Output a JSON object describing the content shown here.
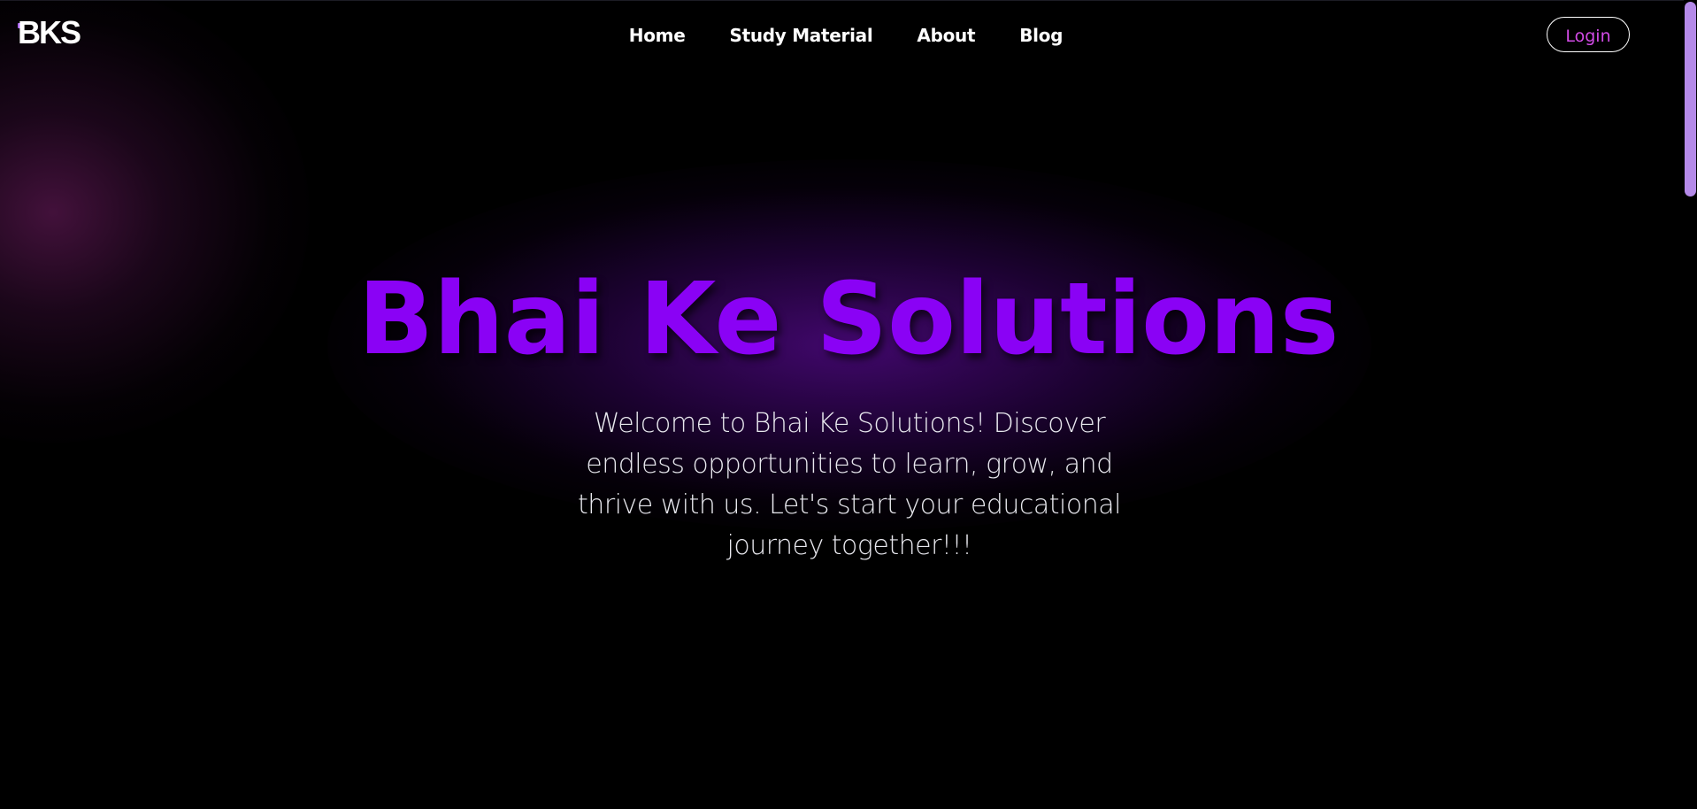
{
  "header": {
    "logo_text": "BKS",
    "nav": [
      {
        "label": "Home"
      },
      {
        "label": "Study Material"
      },
      {
        "label": "About"
      },
      {
        "label": "Blog"
      }
    ],
    "login_label": "Login"
  },
  "hero": {
    "title": "Bhai Ke Solutions",
    "subtitle": "Welcome to Bhai Ke Solutions! Discover endless opportunities to learn, grow, and thrive with us. Let's start your educational journey together!!!"
  },
  "colors": {
    "background": "#000000",
    "accent_purple": "#8a02f5",
    "login_text": "#d24be6",
    "scrollbar_thumb": "#b58ae9"
  }
}
